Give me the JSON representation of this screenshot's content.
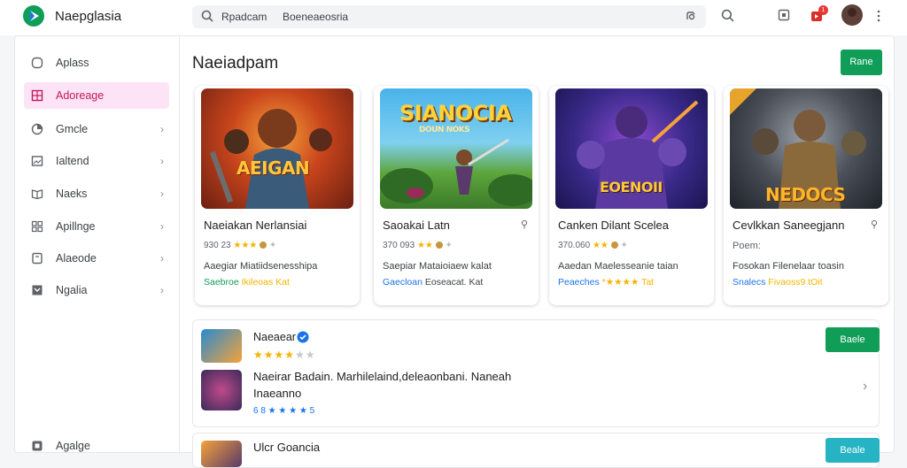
{
  "app": {
    "title": "Naepglasia"
  },
  "search": {
    "query": "Rpadcam",
    "query2": "Boeneaeosria"
  },
  "notifications": {
    "count": "1"
  },
  "sidebar": {
    "items": [
      {
        "label": "Aplass",
        "icon": "circle-icon"
      },
      {
        "label": "Adoreage",
        "icon": "grid-icon"
      },
      {
        "label": "Gmcle",
        "icon": "chart-icon"
      },
      {
        "label": "Ialtend",
        "icon": "image-icon"
      },
      {
        "label": "Naeks",
        "icon": "book-icon"
      },
      {
        "label": "Apillnge",
        "icon": "apps-icon"
      },
      {
        "label": "Alaeode",
        "icon": "tag-icon"
      },
      {
        "label": "Ngalia",
        "icon": "flag-icon"
      },
      {
        "label": "Agalge",
        "icon": "gift-icon"
      }
    ],
    "active_index": 1
  },
  "main": {
    "title": "Naeiadpam",
    "header_button": "Rane"
  },
  "cards": [
    {
      "art_text": "AEIGAN",
      "title": "Naeiakan Nerlansiai",
      "meta": "930 23",
      "rating_stars": 3,
      "desc": "Aaegiar Miatiidsenesshipa",
      "foot_a": "Saebroe",
      "foot_b": "Ikileoas Kat",
      "foot_color": "#0f9d58"
    },
    {
      "art_text": "SIANOCIA",
      "art_sub": "DOUN NOKS",
      "title": "Saoakai Latn",
      "meta": "370 093",
      "rating_stars": 2,
      "desc": "Saepiar Mataioiaew kalat",
      "foot_a": "Gaecloan",
      "foot_b": "Eoseacat. Kat",
      "foot_color": "#1a73e8"
    },
    {
      "art_text": "EOENOII",
      "title": "Canken Dilant Scelea",
      "meta": "370.060",
      "rating_stars": 2,
      "desc": "Aaedan Maelesseanie taian",
      "foot_a": "Peaeches",
      "foot_b": "*★★★★ Tat",
      "foot_color": "#1a73e8"
    },
    {
      "art_text": "NEDOCS",
      "title": "Cevlkkan Saneegjann",
      "meta": "Poem:",
      "rating_stars": 0,
      "desc": "Fosokan Filenelaar toasin",
      "foot_a": "Snalecs",
      "foot_b": "Fivaoss9 tOit",
      "foot_color": "#1a73e8"
    }
  ],
  "list_item": {
    "title": "Naeaear",
    "rating_stars": 4,
    "desc": "Naeirar Badain. Marhilelaind,deleaonbani. Naneah",
    "desc2": "Inaeanno",
    "meta": "6 8 ★ ★ ★ ★ 5",
    "button": "Baele"
  },
  "list_item2": {
    "title": "Ulcr Goancia",
    "button": "Beale"
  },
  "colors": {
    "accent_green": "#0f9d58",
    "accent_teal": "#26b4c4",
    "active_pink": "#fce4f6"
  }
}
